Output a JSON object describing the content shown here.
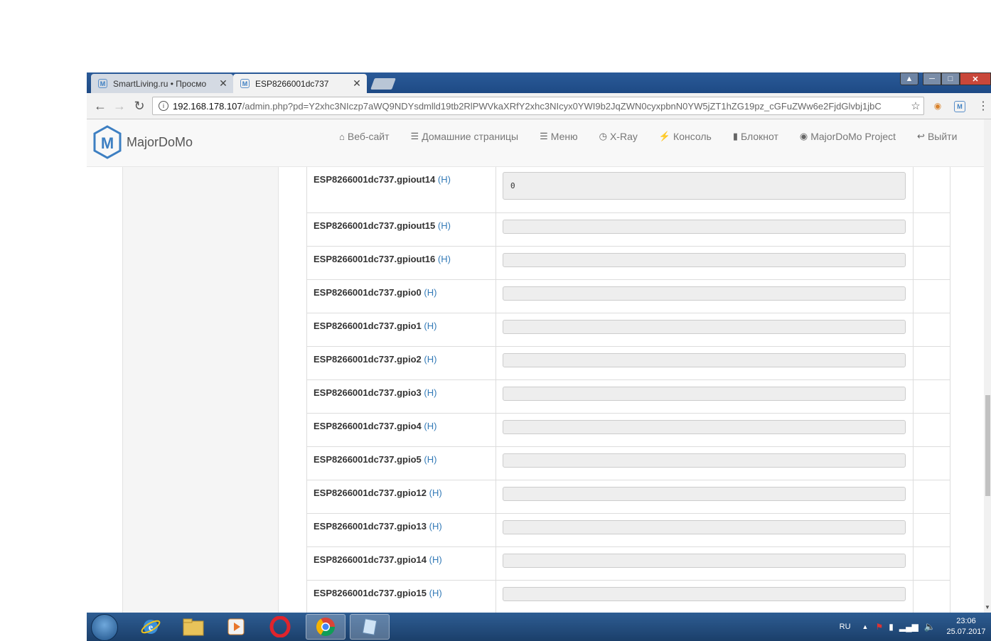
{
  "browser": {
    "tabs": [
      {
        "title": "SmartLiving.ru • Просмо",
        "close": "✕",
        "active": false
      },
      {
        "title": "ESP8266001dc737",
        "close": "✕",
        "active": true
      }
    ],
    "url_host": "192.168.178.107",
    "url_path": "/admin.php?pd=Y2xhc3NIczp7aWQ9NDYsdmlld19tb2RlPWVkaXRfY2xhc3NIcyx0YWI9b2JqZWN0cyxpbnN0YW5jZT1hZG19pz_cGFuZWw6e2FjdGlvbj1jbC"
  },
  "navbar": {
    "brand": "MajorDoMo",
    "items": [
      {
        "icon": "home-icon",
        "label": "Веб-сайт"
      },
      {
        "icon": "list-icon",
        "label": "Домашние страницы"
      },
      {
        "icon": "list-icon",
        "label": "Меню"
      },
      {
        "icon": "dashboard-icon",
        "label": "X-Ray"
      },
      {
        "icon": "flash-icon",
        "label": "Консоль"
      },
      {
        "icon": "notebook-icon",
        "label": "Блокнот"
      },
      {
        "icon": "globe-icon",
        "label": "MajorDoMo Project"
      },
      {
        "icon": "logout-icon",
        "label": "Выйти"
      }
    ]
  },
  "properties": [
    {
      "name": "ESP8266001dc737.gpiout14",
      "link": "(H)",
      "value": "0"
    },
    {
      "name": "ESP8266001dc737.gpiout15",
      "link": "(H)",
      "value": ""
    },
    {
      "name": "ESP8266001dc737.gpiout16",
      "link": "(H)",
      "value": ""
    },
    {
      "name": "ESP8266001dc737.gpio0",
      "link": "(H)",
      "value": ""
    },
    {
      "name": "ESP8266001dc737.gpio1",
      "link": "(H)",
      "value": ""
    },
    {
      "name": "ESP8266001dc737.gpio2",
      "link": "(H)",
      "value": ""
    },
    {
      "name": "ESP8266001dc737.gpio3",
      "link": "(H)",
      "value": ""
    },
    {
      "name": "ESP8266001dc737.gpio4",
      "link": "(H)",
      "value": ""
    },
    {
      "name": "ESP8266001dc737.gpio5",
      "link": "(H)",
      "value": ""
    },
    {
      "name": "ESP8266001dc737.gpio12",
      "link": "(H)",
      "value": ""
    },
    {
      "name": "ESP8266001dc737.gpio13",
      "link": "(H)",
      "value": ""
    },
    {
      "name": "ESP8266001dc737.gpio14",
      "link": "(H)",
      "value": ""
    },
    {
      "name": "ESP8266001dc737.gpio15",
      "link": "(H)",
      "value": ""
    }
  ],
  "taskbar": {
    "lang": "RU",
    "time": "23:06",
    "date": "25.07.2017"
  },
  "colors": {
    "link": "#337ab7",
    "taskbar": "#1f4775",
    "logo": "#3d7fc2"
  }
}
